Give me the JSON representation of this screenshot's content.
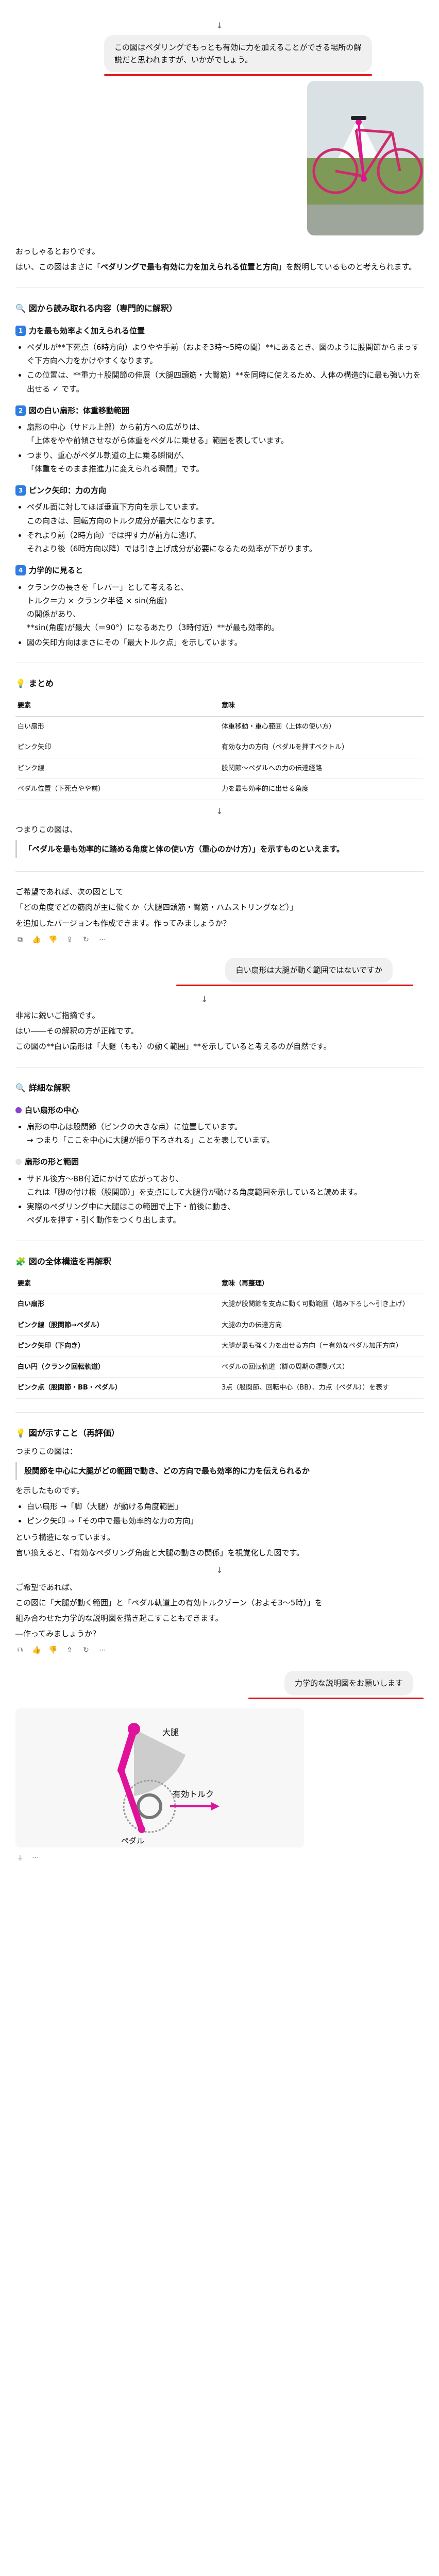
{
  "colors": {
    "accent": "#2f7de1",
    "highlight_line": "#e0161b",
    "magenta": "#e0129a",
    "gray_sector": "#c8c8c8"
  },
  "msg1": {
    "text": "この図はペダリングでもっとも有効に力を加えることができる場所の解説だと思われますが、いかがでしょう。"
  },
  "resp1": {
    "intro1": "おっしゃるとおりです。",
    "intro2_a": "はい、この図はまさに「",
    "intro2_b": "ペダリングで最も有効に力を加えられる位置と方向",
    "intro2_c": "」を説明しているものと考えられます。",
    "heading": "図から読み取れる内容（専門的に解釈）",
    "s1": {
      "num": "1",
      "title": "力を最も効率よく加えられる位置",
      "b1": "ペダルが**下死点（6時方向）よりやや手前（およそ3時〜5時の間）**にあるとき、図のように股関節からまっすぐ下方向へ力をかけやすくなります。",
      "b2": "この位置は、**重力＋股関節の伸展（大腿四頭筋・大臀筋）**を同時に使えるため、人体の構造的に最も強い力を出せる ✓ です。"
    },
    "s2": {
      "num": "2",
      "title": "図の白い扇形：体重移動範囲",
      "b1": "扇形の中心（サドル上部）から前方への広がりは、",
      "b1b": "「上体をやや前傾させながら体重をペダルに乗せる」範囲を表しています。",
      "b2": "つまり、重心がペダル軌道の上に乗る瞬間が、",
      "b2b": "「体重をそのまま推進力に変えられる瞬間」です。"
    },
    "s3": {
      "num": "3",
      "title": "ピンク矢印：力の方向",
      "b1": "ペダル面に対してほぼ垂直下方向を示しています。",
      "b1b": "この向きは、回転方向のトルク成分が最大になります。",
      "b2": "それより前（2時方向）では押す力が前方に逃げ、",
      "b2b": "それより後（6時方向以降）では引き上げ成分が必要になるため効率が下がります。"
    },
    "s4": {
      "num": "4",
      "title": "力学的に見ると",
      "b1": "クランクの長さを「レバー」として考えると、",
      "b1b": "トルク＝力 × クランク半径 × sin(角度)",
      "b1c": "の関係があり、",
      "b1d": "**sin(角度)が最大（＝90°）になるあたり（3時付近）**が最も効率的。",
      "b2": "図の矢印方向はまさにその「最大トルク点」を示しています。"
    },
    "summary_heading": "まとめ",
    "table_headers": [
      "要素",
      "意味"
    ],
    "table_rows": [
      [
        "白い扇形",
        "体重移動・重心範囲（上体の使い方）"
      ],
      [
        "ピンク矢印",
        "有効な力の方向（ペダルを押すベクトル）"
      ],
      [
        "ピンク線",
        "股関節〜ペダルへの力の伝達経路"
      ],
      [
        "ペダル位置（下死点やや前）",
        "力を最も効率的に出せる角度"
      ]
    ],
    "conclusion1": "つまりこの図は、",
    "conclusion2": "「ペダルを最も効率的に踏める角度と体の使い方（重心のかけ方）」を示すものといえます。",
    "offer1": "ご希望であれば、次の図として",
    "offer2": "「どの角度でどの筋肉が主に働くか（大腿四頭筋・臀筋・ハムストリングなど）」",
    "offer3": "を追加したバージョンも作成できます。作ってみましょうか？"
  },
  "msg2": {
    "text": "白い扇形は大腿が動く範囲ではないですか"
  },
  "resp2": {
    "intro1": "非常に鋭いご指摘です。",
    "intro2": "はい――その解釈の方が正確です。",
    "intro3": "この図の**白い扇形は「大腿（もも）の動く範囲」**を示していると考えるのが自然です。",
    "heading": "詳細な解釈",
    "h_a": "白い扇形の中心",
    "a1": "扇形の中心は股関節（ピンクの大きな点）に位置しています。",
    "a1b": "→ つまり「ここを中心に大腿が振り下ろされる」ことを表しています。",
    "h_b": "扇形の形と範囲",
    "b1": "サドル後方〜BB付近にかけて広がっており、",
    "b1b": "これは「脚の付け根（股関節）」を支点にして大腿骨が動ける角度範囲を示していると読めます。",
    "b2": "実際のペダリング中に大腿はこの範囲で上下・前後に動き、",
    "b2b": "ペダルを押す・引く動作をつくり出します。",
    "h_c": "図の全体構造を再解釈",
    "table_headers": [
      "要素",
      "意味（再整理）"
    ],
    "table_rows": [
      [
        "白い扇形",
        "大腿が股関節を支点に動く可動範囲（踏み下ろし〜引き上げ）"
      ],
      [
        "ピンク線（股関節→ペダル）",
        "大腿の力の伝達方向"
      ],
      [
        "ピンク矢印（下向き）",
        "大腿が最も強く力を出せる方向（＝有効なペダル加圧方向）"
      ],
      [
        "白い円（クランク回転軌道）",
        "ペダルの回転軌道（脚の周期の運動パス）"
      ],
      [
        "ピンク点（股関節・BB・ペダル）",
        "3点（股関節、回転中心（BB）、力点（ペダル））を表す"
      ]
    ],
    "h_d": "図が示すこと（再評価）",
    "d1": "つまりこの図は：",
    "d2": "股関節を中心に大腿がどの範囲で動き、どの方向で最も効率的に力を伝えられるか",
    "d3": "を示したものです。",
    "d4": "白い扇形 →「脚（大腿）が動ける角度範囲」",
    "d5": "ピンク矢印 →「その中で最も効率的な力の方向」",
    "d6": "という構造になっています。",
    "d7": "言い換えると、「有効なペダリング角度と大腿の動きの関係」を視覚化した図です。",
    "offer1": "ご希望であれば、",
    "offer2": "この図に「大腿が動く範囲」と「ペダル軌道上の有効トルクゾーン（およそ3〜5時）」を",
    "offer3": "組み合わせた力学的な説明図を描き起こすこともできます。",
    "offer4": "―作ってみましょうか？"
  },
  "msg3": {
    "text": "力学的な説明図をお願いします"
  },
  "diagram": {
    "label_thigh": "大腿",
    "label_torque": "有効トルク",
    "label_pedal": "ペダル"
  }
}
